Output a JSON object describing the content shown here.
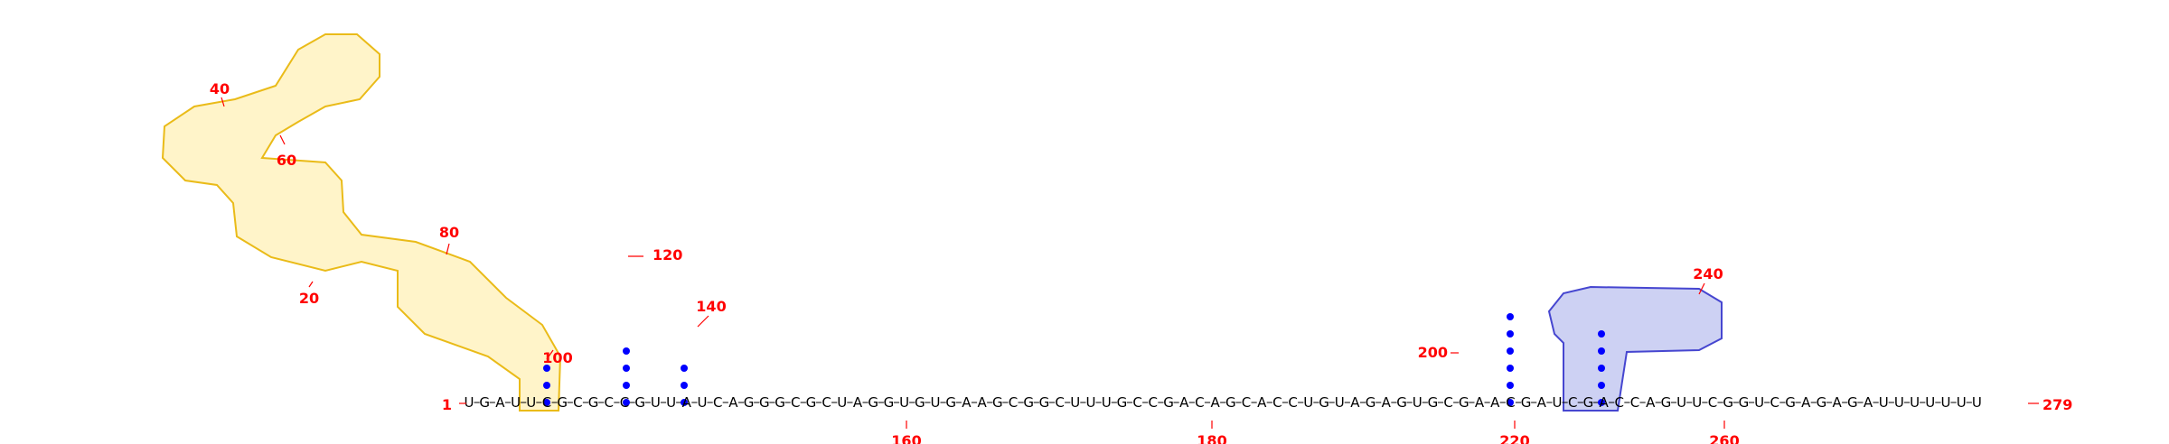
{
  "diagram": {
    "type": "rna-secondary-structure",
    "colors": {
      "base": "#000000",
      "pair_dot": "#0000ff",
      "number": "#ff0000",
      "highlight_yellow_stroke": "#e8b400",
      "highlight_yellow_fill": "#fff3c4",
      "highlight_blue_stroke": "#3333cc",
      "highlight_blue_fill": "#c8cdf2"
    },
    "backbone_sequence": "UGAUUCGCGCCGUUAUCAGGGCGCUAGGUGUGAAGCGGCUUUGCCGACAGCACCUGUAGAGUGCGAACGAUCGACCAGUUCGGUCGAGAGAUUUUUUU",
    "position_labels": [
      "1",
      "20",
      "40",
      "60",
      "80",
      "100",
      "120",
      "140",
      "160",
      "180",
      "200",
      "220",
      "240",
      "260",
      "279"
    ]
  }
}
